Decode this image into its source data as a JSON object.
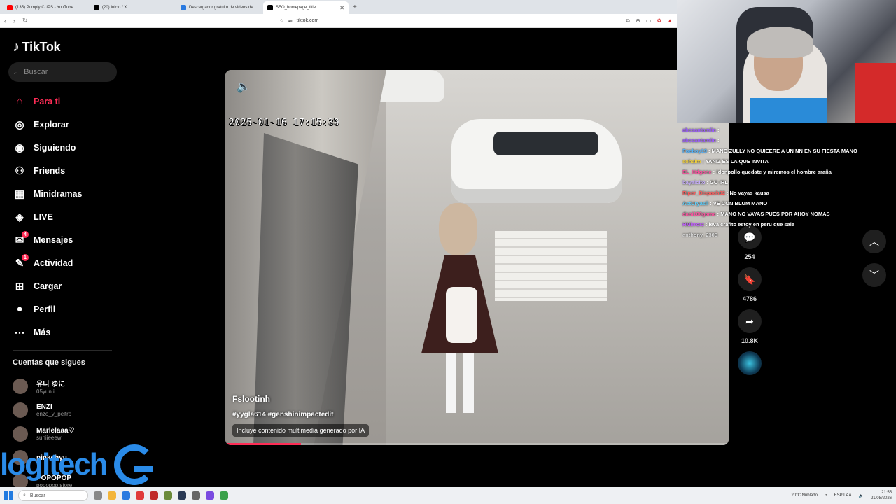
{
  "browser": {
    "tabs": [
      {
        "label": "(135) Pumpiy CUPS - YouTube",
        "color": "#ff0000",
        "active": false
      },
      {
        "label": "(20) Inicio / X",
        "color": "#000000",
        "active": false
      },
      {
        "label": "Descargador gratuito de videos de ",
        "color": "#2a7ae0",
        "active": false
      },
      {
        "label": "SEO_homepage_title",
        "color": "#000000",
        "active": true
      }
    ],
    "url": "tiktok.com"
  },
  "tiktok": {
    "brand": "TikTok",
    "search_placeholder": "Buscar",
    "menu": [
      {
        "icon": "home-icon",
        "glyph": "⌂",
        "label": "Para ti",
        "active": true
      },
      {
        "icon": "compass-icon",
        "glyph": "◎",
        "label": "Explorar",
        "active": false
      },
      {
        "icon": "following-icon",
        "glyph": "◉",
        "label": "Siguiendo",
        "active": false
      },
      {
        "icon": "friends-icon",
        "glyph": "⚇",
        "label": "Friends",
        "active": false
      },
      {
        "icon": "minidramas-icon",
        "glyph": "▦",
        "label": "Minidramas",
        "active": false
      },
      {
        "icon": "live-icon",
        "glyph": "◈",
        "label": "LIVE",
        "active": false
      },
      {
        "icon": "messages-icon",
        "glyph": "✉",
        "label": "Mensajes",
        "active": false,
        "badge": "4"
      },
      {
        "icon": "activity-icon",
        "glyph": "✎",
        "label": "Actividad",
        "active": false,
        "badge": "1"
      },
      {
        "icon": "upload-icon",
        "glyph": "⊞",
        "label": "Cargar",
        "active": false
      },
      {
        "icon": "profile-icon",
        "glyph": "●",
        "label": "Perfil",
        "active": false
      },
      {
        "icon": "more-icon",
        "glyph": "⋯",
        "label": "Más",
        "active": false
      }
    ],
    "following_title": "Cuentas que sigues",
    "following": [
      {
        "name": "유니 ゆに",
        "user": "05yun.i"
      },
      {
        "name": "ENZI",
        "user": "enzo_y_peltro"
      },
      {
        "name": "Marlelaaa♡",
        "user": "suniieeew"
      },
      {
        "name": "pinkchyu",
        "user": ""
      },
      {
        "name": "POPOPOP",
        "user": "popopop.store"
      }
    ],
    "video": {
      "timestamp": "2025-01-16  17:15:39",
      "author": "Fslootinh",
      "tags": "#yygla614 #genshinimpactedit",
      "ai_note": "Incluye contenido multimedia generado por IA",
      "progress": 0.15
    },
    "actions": [
      {
        "icon": "comment-icon",
        "glyph": "💬",
        "count": "254"
      },
      {
        "icon": "bookmark-icon",
        "glyph": "🔖",
        "count": "4786"
      },
      {
        "icon": "share-icon",
        "glyph": "➦",
        "count": "10.8K"
      }
    ]
  },
  "overlay": {
    "logo_text": "logitech",
    "chat": [
      {
        "user": "abcsantamlin",
        "color": "#9b59ff",
        "msg": ":"
      },
      {
        "user": "abcsantamlin",
        "color": "#9b59ff",
        "msg": ":"
      },
      {
        "user": "Foeboy19",
        "color": "#4fb3ff",
        "msg": ": MANO ZULLY NO QUIEERE A UN NN EN SU FIESTA MANO"
      },
      {
        "user": "sohaim",
        "color": "#f2d13a",
        "msg": ": YANIZ ES LA QUE INVITA"
      },
      {
        "user": "EL_Hdgone",
        "color": "#ff4fa0",
        "msg": ": !donpollo quedate y miremos el hombre araña"
      },
      {
        "user": "bayalcito",
        "color": "#c9b0ff",
        "msg": ": GO IRL"
      },
      {
        "user": "Riper_Dispach02",
        "color": "#ff5a5a",
        "msg": ": No vayas kausa"
      },
      {
        "user": "AstUryasll",
        "color": "#5ad0ff",
        "msg": ": VE CON BLUM MANO"
      },
      {
        "user": "dani100game",
        "color": "#ff4fa0",
        "msg": ": MANO NO VAYAS PUES POR AHOY NOMAS"
      },
      {
        "user": "HMirrorz",
        "color": "#c05aff",
        "msg": ": leva crafito estoy en peru que sale"
      },
      {
        "user": "anthony_2309",
        "color": "#dddddd",
        "msg": ""
      }
    ]
  },
  "taskbar": {
    "search_placeholder": "Buscar",
    "weather": "20°C Nublado",
    "lang": "ESP LAA",
    "time": "21:55",
    "date": "21/08/2026"
  }
}
